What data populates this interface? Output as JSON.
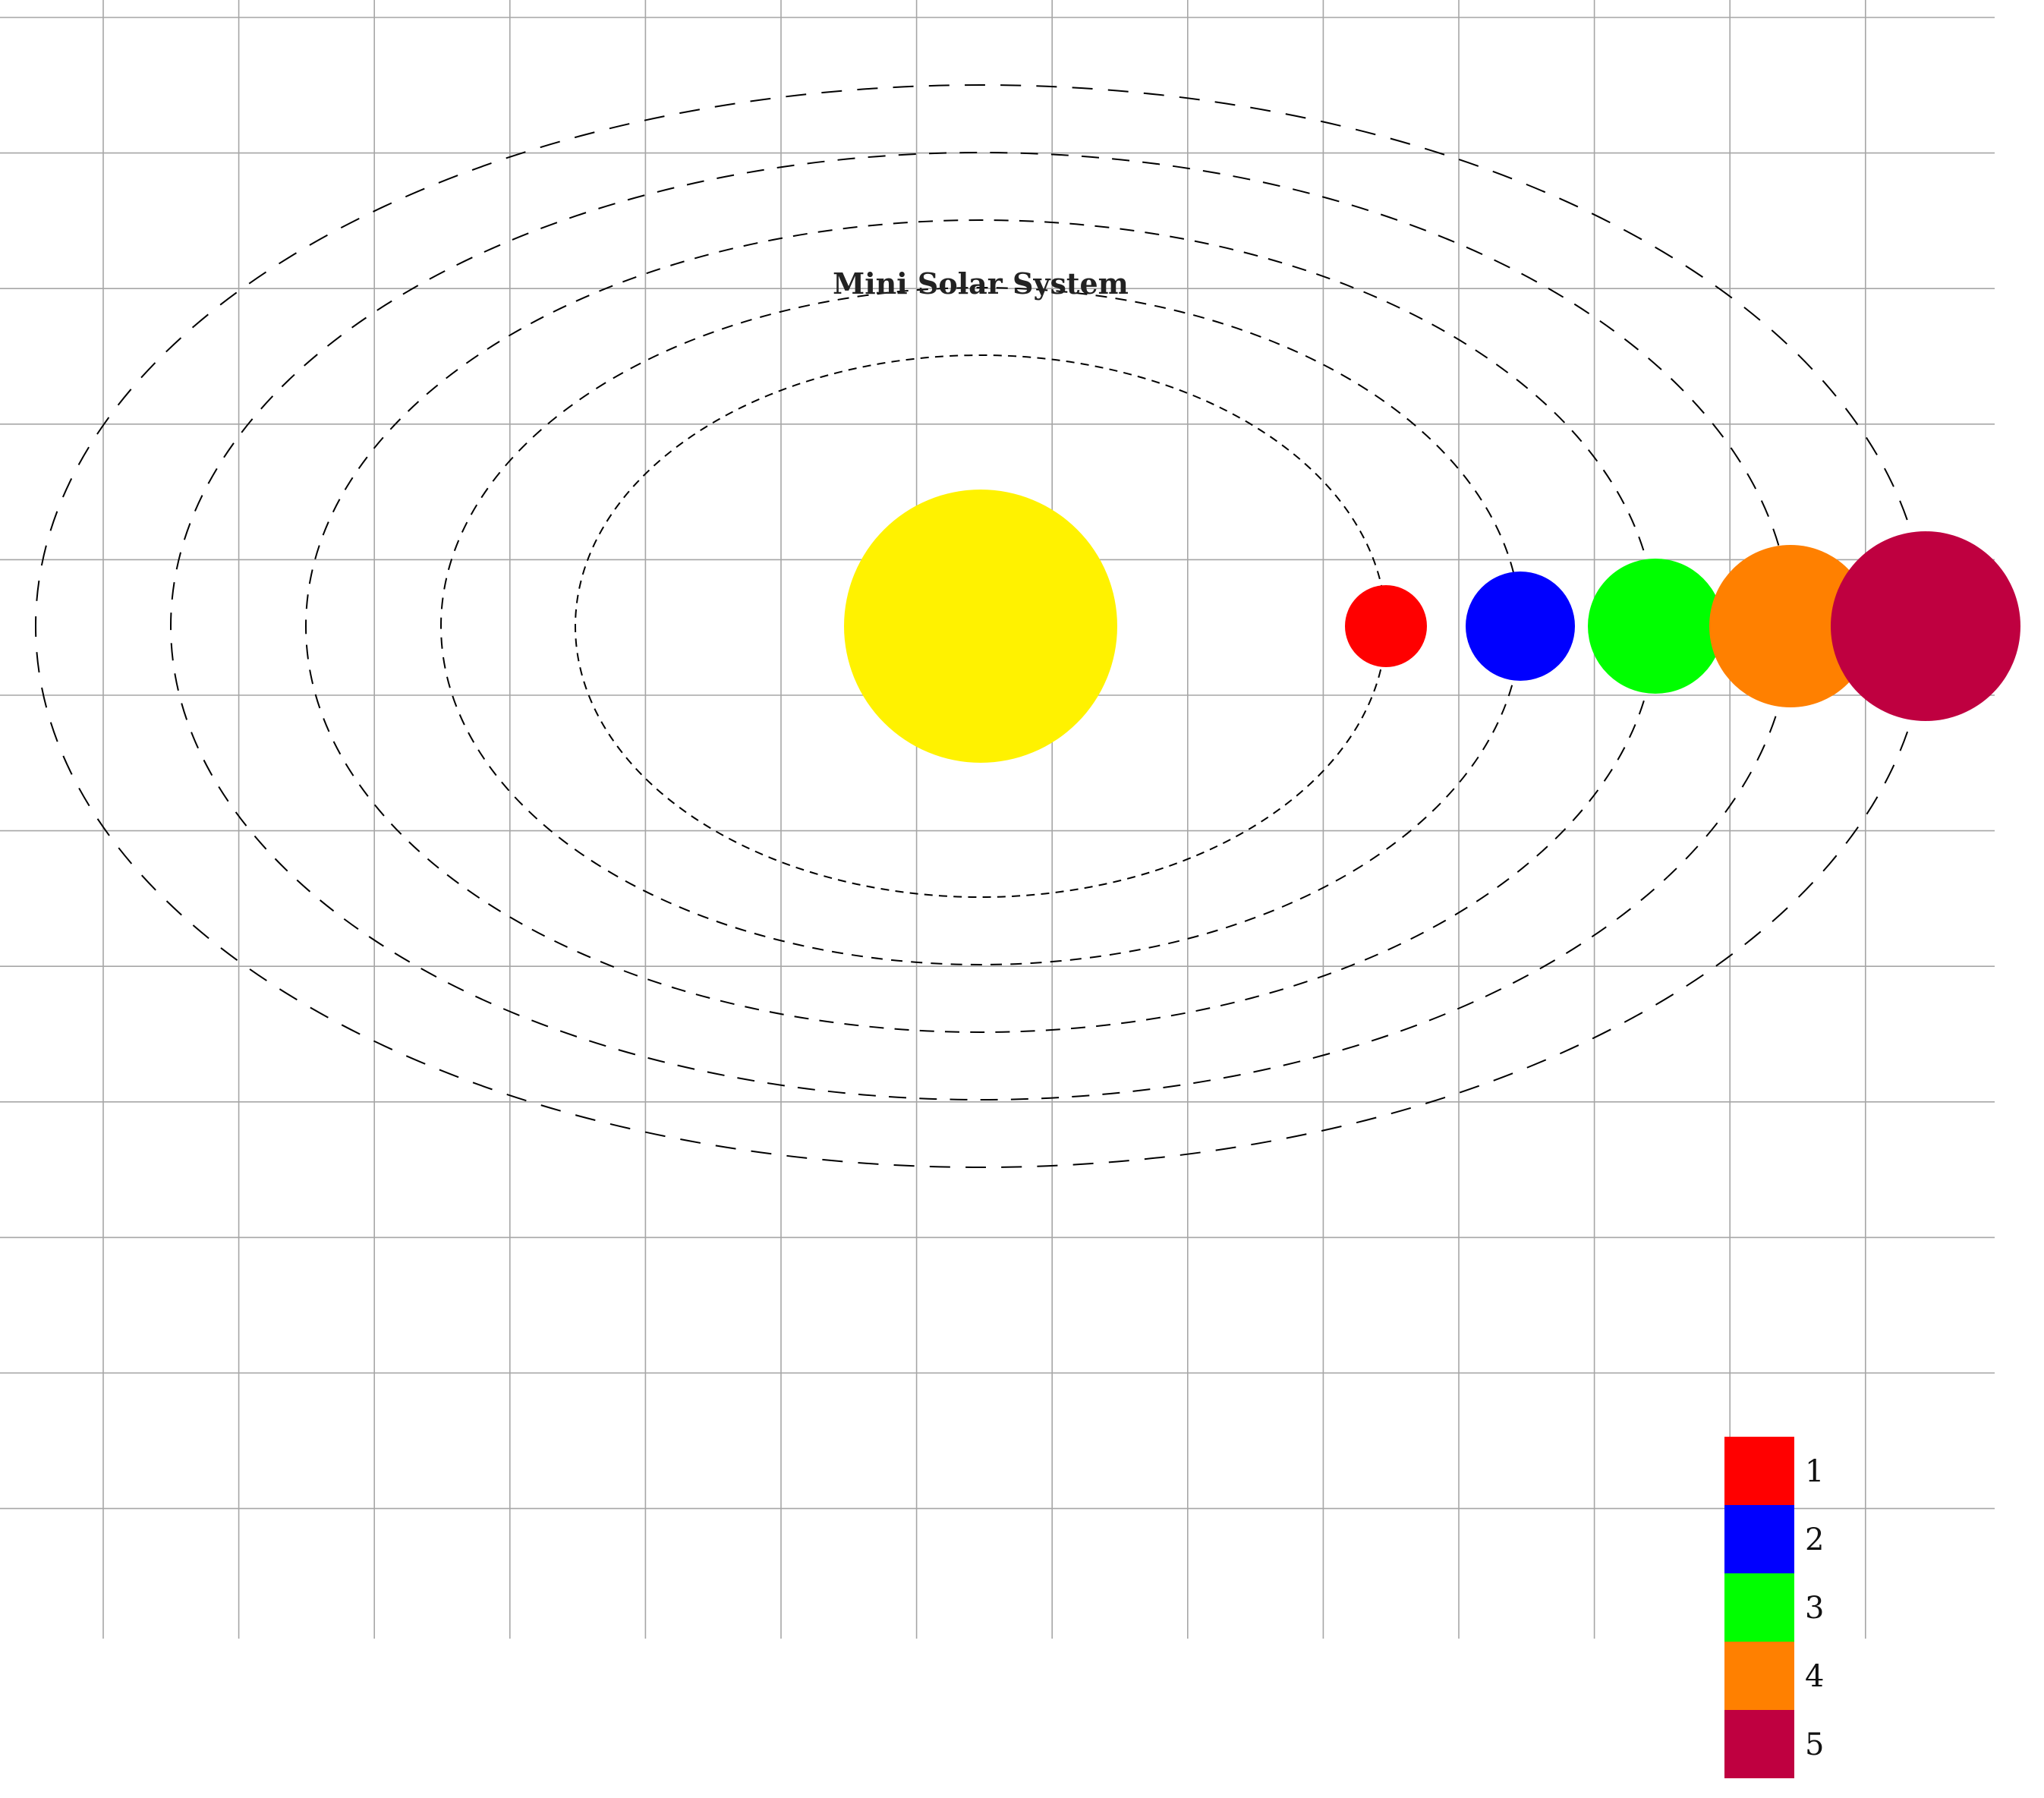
{
  "title": "Mini Solar System",
  "colors": {
    "grid": "#a6a6a6",
    "orbit": "#000000",
    "sun": "#fff200"
  },
  "sun": {
    "name": "sun",
    "color": "#fff200"
  },
  "planets": [
    {
      "label": "1",
      "color": "#ff0000"
    },
    {
      "label": "2",
      "color": "#0000ff"
    },
    {
      "label": "3",
      "color": "#00ff00"
    },
    {
      "label": "4",
      "color": "#ff8000"
    },
    {
      "label": "5",
      "color": "#bf0040"
    }
  ],
  "legend": [
    {
      "label": "1",
      "color": "#ff0000"
    },
    {
      "label": "2",
      "color": "#0000ff"
    },
    {
      "label": "3",
      "color": "#00ff00"
    },
    {
      "label": "4",
      "color": "#ff8000"
    },
    {
      "label": "5",
      "color": "#bf0040"
    }
  ]
}
